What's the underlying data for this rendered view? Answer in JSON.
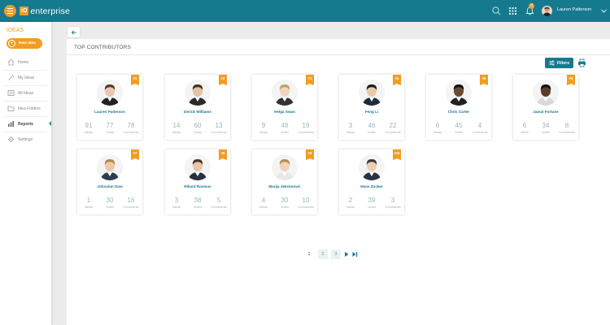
{
  "app": {
    "logo_badge": "iO",
    "logo_text": "enterprise",
    "notification_count": "9",
    "user_name": "Lauren Patterson"
  },
  "sidebar": {
    "title": "IDEAS",
    "new_idea": "New Idea",
    "items": [
      {
        "label": "Home"
      },
      {
        "label": "My Ideas"
      },
      {
        "label": "All Ideas"
      },
      {
        "label": "Idea Folders"
      },
      {
        "label": "Reports"
      },
      {
        "label": "Settings"
      }
    ]
  },
  "main": {
    "title": "TOP CONTRIBUTORS",
    "filters_label": "Filters",
    "stat_labels": {
      "ideas": "Ideas",
      "votes": "Votes",
      "comments": "Comments"
    }
  },
  "contributors": [
    {
      "rank": "#1",
      "name": "Lauren Patterson",
      "ideas": "91",
      "votes": "77",
      "comments": "78",
      "skin": "#e8c8b0",
      "hair": "#5a3a26",
      "outfit": "#222"
    },
    {
      "rank": "#2",
      "name": "Derick Williams",
      "ideas": "14",
      "votes": "60",
      "comments": "13",
      "skin": "#e3c2a5",
      "hair": "#4a3022",
      "outfit": "#2a2a2a"
    },
    {
      "rank": "#3",
      "name": "Helga Swan",
      "ideas": "9",
      "votes": "48",
      "comments": "19",
      "skin": "#f0d5c0",
      "hair": "#c9a060",
      "outfit": "#333"
    },
    {
      "rank": "#4",
      "name": "Feng Li",
      "ideas": "3",
      "votes": "46",
      "comments": "22",
      "skin": "#e8cba8",
      "hair": "#1c1c1c",
      "outfit": "#1f2a3a"
    },
    {
      "rank": "#5",
      "name": "Chris Carter",
      "ideas": "6",
      "votes": "45",
      "comments": "4",
      "skin": "#6b4a32",
      "hair": "#111",
      "outfit": "#222"
    },
    {
      "rank": "#6",
      "name": "Jamal Fortune",
      "ideas": "6",
      "votes": "34",
      "comments": "8",
      "skin": "#5a3d2a",
      "hair": "#111",
      "outfit": "#d9d9d9"
    },
    {
      "rank": "#7",
      "name": "Johnatan Dow",
      "ideas": "1",
      "votes": "30",
      "comments": "16",
      "skin": "#eac9ad",
      "hair": "#b8864c",
      "outfit": "#2c3e50"
    },
    {
      "rank": "#8",
      "name": "Rikard Rasmus",
      "ideas": "3",
      "votes": "38",
      "comments": "5",
      "skin": "#e8c6a8",
      "hair": "#4a3626",
      "outfit": "#26323f"
    },
    {
      "rank": "#9",
      "name": "Marija Jeksimović",
      "ideas": "4",
      "votes": "30",
      "comments": "10",
      "skin": "#f0d3bd",
      "hair": "#b88d55",
      "outfit": "#e8e8e8"
    },
    {
      "rank": "#10",
      "name": "Hans Zucker",
      "ideas": "2",
      "votes": "39",
      "comments": "3",
      "skin": "#eccdb3",
      "hair": "#3a3a3a",
      "outfit": "#2a3340"
    }
  ],
  "pagination": {
    "pages": [
      "1",
      "2",
      "3"
    ]
  }
}
